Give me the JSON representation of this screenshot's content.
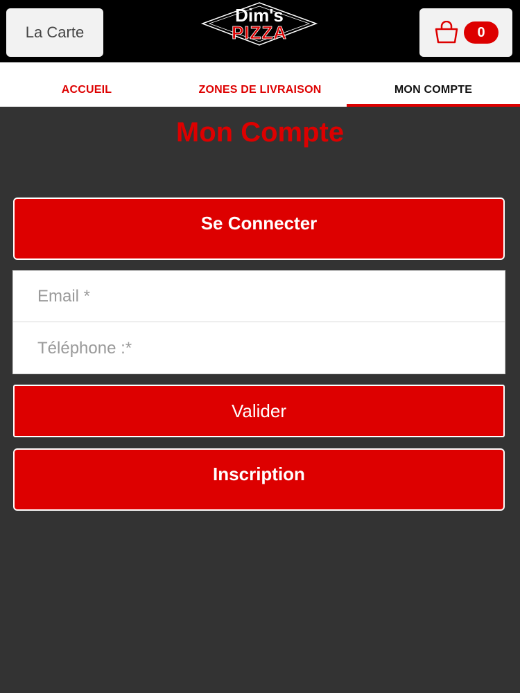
{
  "header": {
    "menu_label": "La Carte",
    "logo_line1": "Dim's",
    "logo_line2": "PIZZA",
    "cart_count": "0"
  },
  "tabs": [
    {
      "label": "ACCUEIL",
      "active": false
    },
    {
      "label": "ZONES DE LIVRAISON",
      "active": false
    },
    {
      "label": "MON COMPTE",
      "active": true
    }
  ],
  "page_title": "Mon Compte",
  "buttons": {
    "connect": "Se Connecter",
    "validate": "Valider",
    "signup": "Inscription"
  },
  "form": {
    "email_placeholder": "Email *",
    "email_value": "",
    "phone_placeholder": "Téléphone :*",
    "phone_value": ""
  },
  "colors": {
    "accent": "#dd0000",
    "background": "#333333",
    "header": "#000000"
  }
}
